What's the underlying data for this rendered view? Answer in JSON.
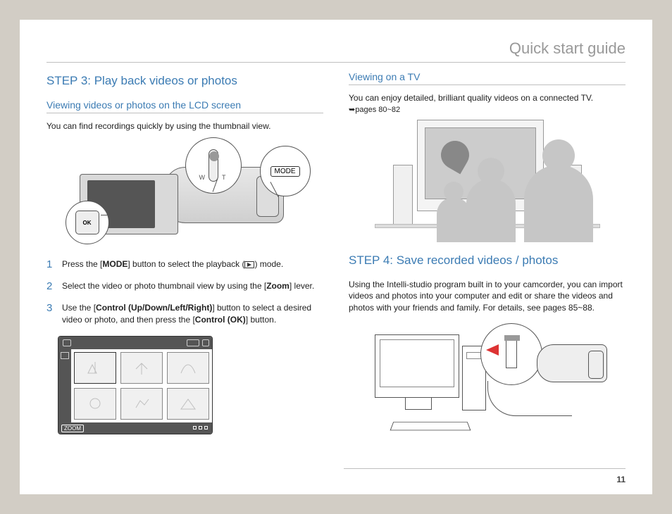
{
  "header": {
    "title": "Quick start guide"
  },
  "left": {
    "step_title": "STEP 3: Play back videos or photos",
    "sub_title": "Viewing videos or photos on the LCD screen",
    "intro": "You can find recordings quickly by using the thumbnail view.",
    "mode_label": "MODE",
    "ok_label": "OK",
    "zoom_label": "ZOOM",
    "steps": [
      {
        "n": "1",
        "pre": "Press the [",
        "b1": "MODE",
        "mid1": "] button to select the playback (",
        "mid2": ") mode."
      },
      {
        "n": "2",
        "pre": "Select the video or photo thumbnail view by using the [",
        "b1": "Zoom",
        "post": "] lever."
      },
      {
        "n": "3",
        "pre": "Use the [",
        "b1": "Control (Up/Down/Left/Right)",
        "mid1": "] button to select a desired video or photo, and then press the [",
        "b2": "Control (OK)",
        "post": "] button."
      }
    ]
  },
  "right": {
    "tv_title": "Viewing on a TV",
    "tv_text": "You can enjoy detailed, brilliant quality videos on a connected TV.",
    "tv_ref": "➥pages 80~82",
    "step4_title": "STEP 4: Save recorded videos / photos",
    "step4_text": "Using the Intelli-studio program built in to your camcorder, you can import videos and photos into your computer and edit or share the videos and photos with your friends and family. For details, see pages 85~88."
  },
  "page_number": "11"
}
